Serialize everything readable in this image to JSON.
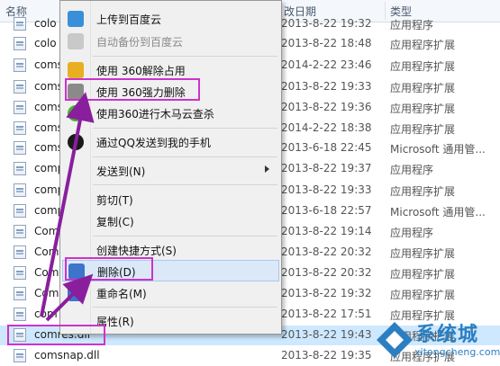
{
  "header": {
    "name": "名称",
    "date": "改日期",
    "type": "类型"
  },
  "files": [
    {
      "name": "colo",
      "date": "2013-8-22 19:32",
      "type": "应用程序"
    },
    {
      "name": "colo",
      "date": "2013-8-22 18:48",
      "type": "应用程序扩展"
    },
    {
      "name": "coms",
      "date": "2014-2-22 23:46",
      "type": "应用程序扩展"
    },
    {
      "name": "coms",
      "date": "2013-8-22 19:33",
      "type": "应用程序扩展"
    },
    {
      "name": "coms",
      "date": "2013-8-22 19:36",
      "type": "应用程序扩展"
    },
    {
      "name": "coms",
      "date": "2014-2-22 18:38",
      "type": "应用程序扩展"
    },
    {
      "name": "coms",
      "date": "2013-6-18 22:45",
      "type": "Microsoft 通用管..."
    },
    {
      "name": "comp",
      "date": "2013-8-22 19:37",
      "type": "应用程序"
    },
    {
      "name": "comp",
      "date": "2013-8-22 19:33",
      "type": "应用程序扩展"
    },
    {
      "name": "comp",
      "date": "2013-6-18 22:57",
      "type": "Microsoft 通用管..."
    },
    {
      "name": "Com",
      "date": "2013-8-22 19:14",
      "type": "应用程序"
    },
    {
      "name": "Com",
      "date": "2013-8-22 20:32",
      "type": "应用程序扩展"
    },
    {
      "name": "Com",
      "date": "2013-8-22 20:32",
      "type": "应用程序扩展"
    },
    {
      "name": "Com",
      "date": "2013-8-22 19:32",
      "type": "应用程序扩展"
    },
    {
      "name": "com",
      "date": "2013-8-22 17:51",
      "type": "应用程序扩展"
    },
    {
      "name": "comres.dll",
      "date": "2013-8-22 19:43",
      "type": "应用程序扩展"
    },
    {
      "name": "comsnap.dll",
      "date": "2013-8-22 19:35",
      "type": "应用程序扩展"
    }
  ],
  "menu": {
    "upload_baidu": "上传到百度云",
    "auto_backup_baidu": "自动备份到百度云",
    "unlock_360": "使用 360解除占用",
    "force_delete_360": "使用 360强力删除",
    "trojan_scan_360": "使用360进行木马云查杀",
    "send_qq": "通过QQ发送到我的手机",
    "send_to": "发送到(N)",
    "cut": "剪切(T)",
    "copy": "复制(C)",
    "create_shortcut": "创建快捷方式(S)",
    "delete": "删除(D)",
    "rename": "重命名(M)",
    "properties": "属性(R)"
  },
  "watermark": {
    "brand": "系统城",
    "url": "xitongcheng.com"
  },
  "colors": {
    "highlight": "#cc33cc",
    "arrow": "#8a1f9e",
    "selected_row": "#cde8ff",
    "menu_hover": "#dbe8f7"
  }
}
